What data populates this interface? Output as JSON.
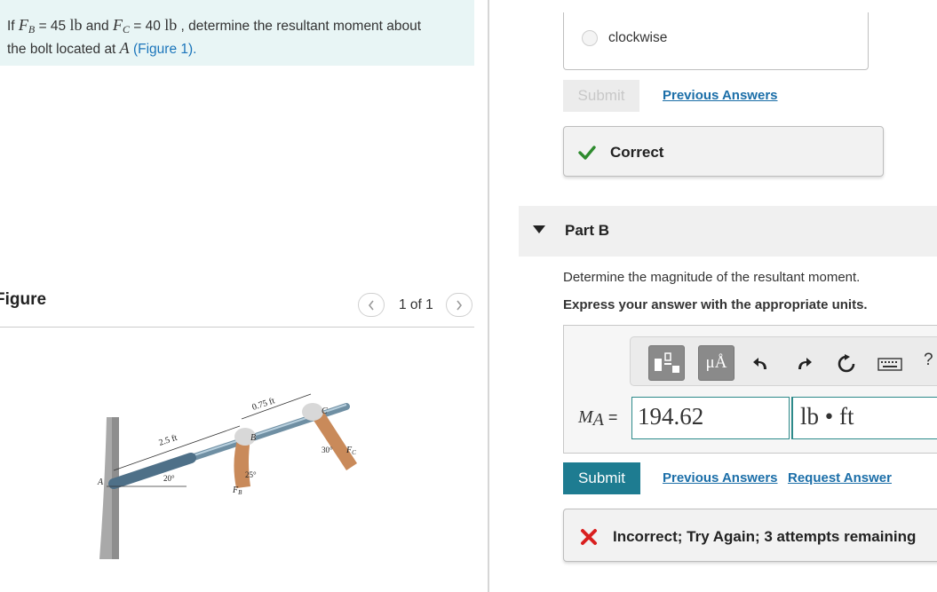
{
  "problem": {
    "prefix": "If ",
    "fb_symbol": "F",
    "fb_sub": "B",
    "fb_value": " = 45 ",
    "fb_unit": "lb",
    "and_text": " and ",
    "fc_symbol": "F",
    "fc_sub": "C",
    "fc_value": " = 40 ",
    "fc_unit": "lb",
    "line1_suffix": " , determine the resultant moment about",
    "line2_prefix": "the bolt located at ",
    "point": "A",
    "open_paren": " (",
    "figure_link": "Figure 1",
    "close_paren": ")."
  },
  "figure": {
    "title": "Figure",
    "pager_text": "1 of 1",
    "prev_icon": "chevron-left-icon",
    "next_icon": "chevron-right-icon",
    "labels": {
      "dim1": "2.5 ft",
      "dim2": "0.75 ft",
      "angle1": "20°",
      "angle2": "25°",
      "angle3": "30°",
      "fb": "F",
      "fb_sub": "B",
      "fc": "F",
      "fc_sub": "C",
      "pt_a": "A",
      "pt_b": "B",
      "pt_c": "C"
    }
  },
  "part_a": {
    "choice_label": "clockwise",
    "submit_label": "Submit",
    "previous_answers": "Previous Answers",
    "feedback": "Correct"
  },
  "part_b": {
    "title": "Part B",
    "instruction": "Determine the magnitude of the resultant moment.",
    "instruction_bold": "Express your answer with the appropriate units.",
    "toolbar": {
      "mu_label": "μÅ",
      "help_label": "?",
      "icons": [
        "templates-icon",
        "units-icon",
        "undo-icon",
        "redo-icon",
        "reset-icon",
        "keyboard-icon",
        "help-icon"
      ]
    },
    "eq_symbol": "M",
    "eq_sub": "A",
    "eq_sign": " =",
    "value": "194.62",
    "unit": "lb • ft",
    "submit_label": "Submit",
    "previous_answers": "Previous Answers",
    "request_answer": "Request Answer",
    "feedback": "Incorrect; Try Again; 3 attempts remaining"
  },
  "colors": {
    "problem_bg": "#e8f5f5",
    "link": "#1b75bb",
    "submit_bg": "#1e7c91",
    "correct": "#2e8b2e",
    "incorrect": "#d92020"
  }
}
